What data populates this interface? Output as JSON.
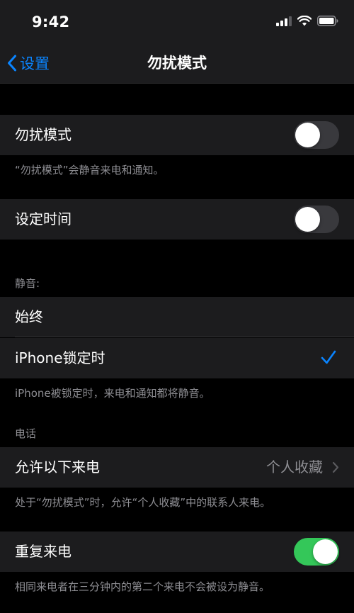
{
  "status_bar": {
    "time": "9:42"
  },
  "nav": {
    "back_label": "设置",
    "title": "勿扰模式"
  },
  "sections": {
    "dnd": {
      "label": "勿扰模式",
      "toggle_on": false,
      "footnote": "“勿扰模式”会静音来电和通知。"
    },
    "scheduled": {
      "label": "设定时间",
      "toggle_on": false
    },
    "silence": {
      "header": "静音:",
      "options": [
        {
          "label": "始终",
          "selected": false
        },
        {
          "label": "iPhone锁定时",
          "selected": true
        }
      ],
      "footnote": "iPhone被锁定时，来电和通知都将静音。"
    },
    "phone": {
      "header": "电话",
      "allow_calls_label": "允许以下来电",
      "allow_calls_value": "个人收藏",
      "footnote": "处于“勿扰模式”时，允许“个人收藏”中的联系人来电。"
    },
    "repeated": {
      "label": "重复来电",
      "toggle_on": true,
      "footnote": "相同来电者在三分钟内的第二个来电不会被设为静音。"
    }
  },
  "colors": {
    "accent": "#0a84ff",
    "toggle_on": "#34c759",
    "cell_bg": "#1c1c1e",
    "secondary_text": "#8e8e93"
  },
  "icons": [
    "cellular-signal-icon",
    "wifi-icon",
    "battery-icon",
    "chevron-left-icon",
    "checkmark-icon",
    "chevron-right-icon"
  ]
}
